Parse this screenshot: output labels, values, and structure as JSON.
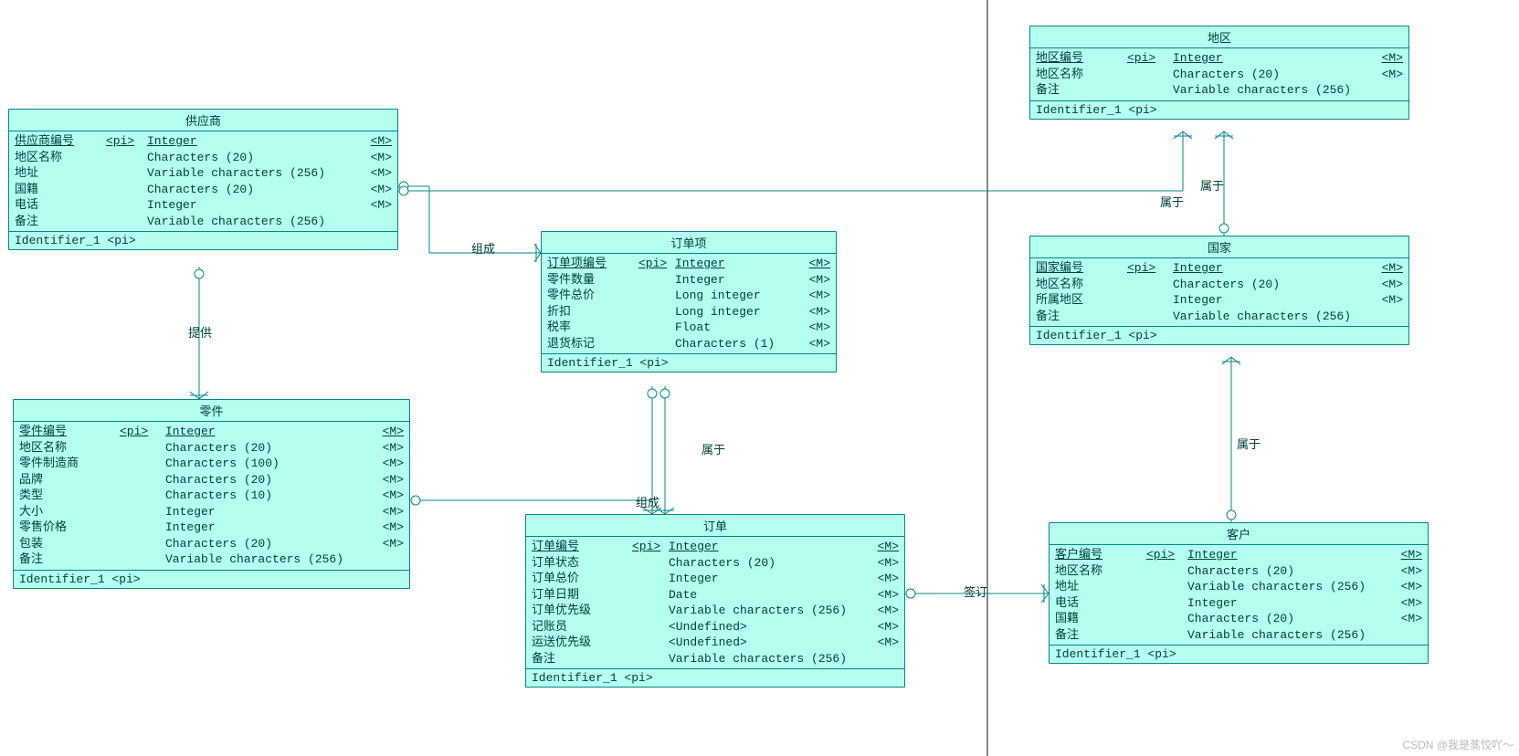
{
  "entities": {
    "supplier": {
      "title": "供应商",
      "rows": [
        {
          "name": "供应商编号",
          "pi": "<pi>",
          "type": "Integer",
          "m": "<M>",
          "u": true
        },
        {
          "name": "地区名称",
          "pi": "",
          "type": "Characters (20)",
          "m": "<M>"
        },
        {
          "name": "地址",
          "pi": "",
          "type": "Variable characters (256)",
          "m": "<M>"
        },
        {
          "name": "国籍",
          "pi": "",
          "type": "Characters (20)",
          "m": "<M>"
        },
        {
          "name": "电话",
          "pi": "",
          "type": "Integer",
          "m": "<M>"
        },
        {
          "name": "备注",
          "pi": "",
          "type": "Variable characters (256)",
          "m": ""
        }
      ],
      "ident": "Identifier_1  <pi>"
    },
    "part": {
      "title": "零件",
      "rows": [
        {
          "name": "零件编号",
          "pi": "<pi>",
          "type": "Integer",
          "m": "<M>",
          "u": true
        },
        {
          "name": "地区名称",
          "pi": "",
          "type": "Characters (20)",
          "m": "<M>"
        },
        {
          "name": "零件制造商",
          "pi": "",
          "type": "Characters (100)",
          "m": "<M>"
        },
        {
          "name": "品牌",
          "pi": "",
          "type": "Characters (20)",
          "m": "<M>"
        },
        {
          "name": "类型",
          "pi": "",
          "type": "Characters (10)",
          "m": "<M>"
        },
        {
          "name": "大小",
          "pi": "",
          "type": "Integer",
          "m": "<M>"
        },
        {
          "name": "零售价格",
          "pi": "",
          "type": "Integer",
          "m": "<M>"
        },
        {
          "name": "包装",
          "pi": "",
          "type": "Characters (20)",
          "m": "<M>"
        },
        {
          "name": "备注",
          "pi": "",
          "type": "Variable characters (256)",
          "m": ""
        }
      ],
      "ident": "Identifier_1  <pi>"
    },
    "orderitem": {
      "title": "订单项",
      "rows": [
        {
          "name": "订单项编号",
          "pi": "<pi>",
          "type": "Integer",
          "m": "<M>",
          "u": true
        },
        {
          "name": "零件数量",
          "pi": "",
          "type": "Integer",
          "m": "<M>"
        },
        {
          "name": "零件总价",
          "pi": "",
          "type": "Long integer",
          "m": "<M>"
        },
        {
          "name": "折扣",
          "pi": "",
          "type": "Long integer",
          "m": "<M>"
        },
        {
          "name": "税率",
          "pi": "",
          "type": "Float",
          "m": "<M>"
        },
        {
          "name": "退货标记",
          "pi": "",
          "type": "Characters (1)",
          "m": "<M>"
        }
      ],
      "ident": "Identifier_1  <pi>"
    },
    "order": {
      "title": "订单",
      "rows": [
        {
          "name": "订单编号",
          "pi": "<pi>",
          "type": "Integer",
          "m": "<M>",
          "u": true
        },
        {
          "name": "订单状态",
          "pi": "",
          "type": "Characters (20)",
          "m": "<M>"
        },
        {
          "name": "订单总价",
          "pi": "",
          "type": "Integer",
          "m": "<M>"
        },
        {
          "name": "订单日期",
          "pi": "",
          "type": "Date",
          "m": "<M>"
        },
        {
          "name": "订单优先级",
          "pi": "",
          "type": "Variable characters (256)",
          "m": "<M>"
        },
        {
          "name": "记账员",
          "pi": "",
          "type": "<Undefined>",
          "m": "<M>"
        },
        {
          "name": "运送优先级",
          "pi": "",
          "type": "<Undefined>",
          "m": "<M>"
        },
        {
          "name": "备注",
          "pi": "",
          "type": "Variable characters (256)",
          "m": ""
        }
      ],
      "ident": "Identifier_1  <pi>"
    },
    "region": {
      "title": "地区",
      "rows": [
        {
          "name": "地区编号",
          "pi": "<pi>",
          "type": "Integer",
          "m": "<M>",
          "u": true
        },
        {
          "name": "地区名称",
          "pi": "",
          "type": "Characters (20)",
          "m": "<M>"
        },
        {
          "name": "备注",
          "pi": "",
          "type": "Variable characters (256)",
          "m": ""
        }
      ],
      "ident": "Identifier_1  <pi>"
    },
    "country": {
      "title": "国家",
      "rows": [
        {
          "name": "国家编号",
          "pi": "<pi>",
          "type": "Integer",
          "m": "<M>",
          "u": true
        },
        {
          "name": "地区名称",
          "pi": "",
          "type": "Characters (20)",
          "m": "<M>"
        },
        {
          "name": "所属地区",
          "pi": "",
          "type": "Integer",
          "m": "<M>"
        },
        {
          "name": "备注",
          "pi": "",
          "type": "Variable characters (256)",
          "m": ""
        }
      ],
      "ident": "Identifier_1  <pi>"
    },
    "customer": {
      "title": "客户",
      "rows": [
        {
          "name": "客户编号",
          "pi": "<pi>",
          "type": "Integer",
          "m": "<M>",
          "u": true
        },
        {
          "name": "地区名称",
          "pi": "",
          "type": "Characters (20)",
          "m": "<M>"
        },
        {
          "name": "地址",
          "pi": "",
          "type": "Variable characters (256)",
          "m": "<M>"
        },
        {
          "name": "电话",
          "pi": "",
          "type": "Integer",
          "m": "<M>"
        },
        {
          "name": "国籍",
          "pi": "",
          "type": "Characters (20)",
          "m": "<M>"
        },
        {
          "name": "备注",
          "pi": "",
          "type": "Variable characters (256)",
          "m": ""
        }
      ],
      "ident": "Identifier_1  <pi>"
    }
  },
  "labels": {
    "provide": "提供",
    "compose1": "组成",
    "compose2": "组成",
    "belong1": "属于",
    "belong2": "属于",
    "belong3": "属于",
    "belong4": "属于",
    "sign": "签订"
  },
  "watermark": "CSDN @我是蒸饺吖～"
}
